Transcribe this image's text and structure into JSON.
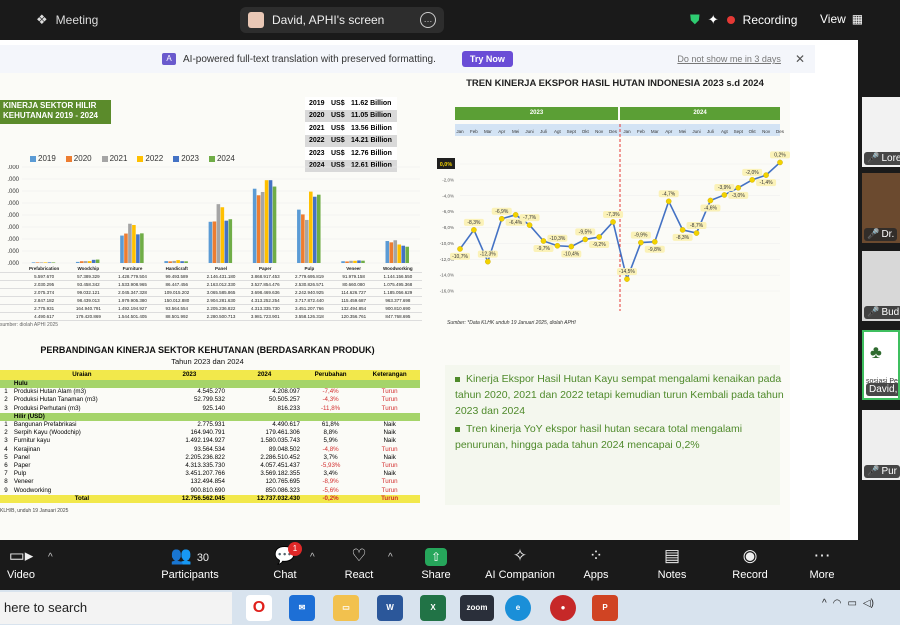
{
  "topbar": {
    "meeting_label": "Meeting",
    "screen_share_label": "David, APHI's screen",
    "recording_label": "Recording",
    "view_label": "View"
  },
  "notice": {
    "ai_text": "AI-powered full-text translation with preserved formatting.",
    "try_label": "Try Now",
    "dont_show": "Do not show me in 3 days"
  },
  "left_chart": {
    "title_lines": [
      "KINERJA SEKTOR HILIR",
      "KEHUTANAN 2019 - 2024"
    ],
    "annotations": [
      {
        "year": "2019",
        "cur": "US$",
        "value": "11.62 Billion"
      },
      {
        "year": "2020",
        "cur": "US$",
        "value": "11.05 Billion"
      },
      {
        "year": "2021",
        "cur": "US$",
        "value": "13.56 Billion"
      },
      {
        "year": "2022",
        "cur": "US$",
        "value": "14.21 Billion"
      },
      {
        "year": "2023",
        "cur": "US$",
        "value": "12.76 Billion"
      },
      {
        "year": "2024",
        "cur": "US$",
        "value": "12.61 Billion"
      }
    ],
    "y_ticks": [
      ".000",
      ".000",
      ".000",
      ".000",
      ".000",
      ".000",
      ".000",
      ".000",
      ".000"
    ],
    "source_note": "sumber: diolah APHI 2025",
    "table_headers": [
      "Prefabrication",
      "Woodchip",
      "Furniture",
      "Handicraft",
      "Panel",
      "Paper",
      "Pulp",
      "Veneer",
      "Woodworking"
    ],
    "table_rows": [
      [
        "5.597.670",
        "57.389.329",
        "1.428.779.504",
        "99.493.589",
        "2.146.431.180",
        "3.868.917.453",
        "2.779.695.819",
        "91.979.158",
        "1.144.156.550"
      ],
      [
        "2.030.295",
        "93.458.342",
        "1.533.908.965",
        "86.447.456",
        "2.163.012.330",
        "3.527.854.476",
        "2.530.826.571",
        "80.660.080",
        "1.075.495.368"
      ],
      [
        "2.075.374",
        "99.032.121",
        "2.045.347.328",
        "109.015.202",
        "3.065.585.865",
        "3.698.469.636",
        "2.242.940.925",
        "114.626.727",
        "1.185.056.629"
      ],
      [
        "2.847.182",
        "98.439.013",
        "1.979.905.380",
        "150.012.880",
        "2.904.281.630",
        "4.313.252.254",
        "3.717.872.440",
        "115.459.687",
        "963.377.698"
      ],
      [
        "2.775.931",
        "164.940.791",
        "1.492.194.927",
        "93.564.554",
        "2.205.236.822",
        "4.313.335.730",
        "3.451.207.766",
        "132.494.854",
        "900.810.690"
      ],
      [
        "4.490.617",
        "179.420.869",
        "1.544.501.405",
        "88.501.992",
        "2.280.500.713",
        "3.981.723.901",
        "3.558.126.318",
        "120.356.761",
        "847.768.695"
      ]
    ]
  },
  "chart_data": [
    {
      "type": "bar",
      "title": "KINERJA SEKTOR HILIR KEHUTANAN 2019 - 2024",
      "categories": [
        "Prefabrication",
        "Woodchip",
        "Furniture",
        "Handicraft",
        "Panel",
        "Paper",
        "Pulp",
        "Veneer",
        "Woodworking"
      ],
      "series": [
        {
          "name": "2019",
          "color": "#5b9bd5",
          "values": [
            5597670,
            57389329,
            1428779504,
            99493589,
            2146431180,
            3868917453,
            2779695819,
            91979158,
            1144156550
          ]
        },
        {
          "name": "2020",
          "color": "#ed7d31",
          "values": [
            2030295,
            93458342,
            1533908965,
            86447456,
            2163012330,
            3527854476,
            2530826571,
            80660080,
            1075495368
          ]
        },
        {
          "name": "2021",
          "color": "#a5a5a5",
          "values": [
            2075374,
            99032121,
            2045347328,
            109015202,
            3065585865,
            3698469636,
            2242940925,
            114626727,
            1185056629
          ]
        },
        {
          "name": "2022",
          "color": "#ffc000",
          "values": [
            2847182,
            98439013,
            1979905380,
            150012880,
            2904281630,
            4313252254,
            3717872440,
            115459687,
            963377698
          ]
        },
        {
          "name": "2023",
          "color": "#4472c4",
          "values": [
            2775931,
            164940791,
            1492194927,
            93564554,
            2205236822,
            4313335730,
            3451207766,
            132494854,
            900810690
          ]
        },
        {
          "name": "2024",
          "color": "#70ad47",
          "values": [
            4490617,
            179420869,
            1544501405,
            88501992,
            2280500713,
            3981723901,
            3558126318,
            120356761,
            847768695
          ]
        }
      ],
      "ylim": [
        0,
        5000000000
      ]
    },
    {
      "type": "line",
      "title": "TREN KINERJA EKSPOR HASIL HUTAN INDONESIA 2023 s.d 2024",
      "x": [
        "Jan",
        "Feb",
        "Mar",
        "Apr",
        "Mei",
        "Juni",
        "Juli",
        "Agt",
        "Sept",
        "Okt",
        "Nov",
        "Des",
        "Jan",
        "Feb",
        "Mar",
        "Apr",
        "Mei",
        "Juni",
        "Juli",
        "Agt",
        "Sept",
        "Okt",
        "Nov",
        "Des"
      ],
      "values": [
        -10.7,
        -8.3,
        -12.3,
        -6.9,
        -6.4,
        -7.7,
        -9.7,
        -10.3,
        -10.4,
        -9.5,
        -9.2,
        -7.3,
        -14.5,
        -9.9,
        -9.8,
        -4.7,
        -8.3,
        -8.7,
        -4.6,
        -3.9,
        -3.0,
        -2.0,
        -1.4,
        0.2
      ],
      "labels": [
        "-10,7%",
        "-8,3%",
        "-12,3%",
        "-6,9%",
        "-6,4%",
        "-7,7%",
        "-9,7%",
        "-10,3%",
        "-10,4%",
        "-9,5%",
        "-9,2%",
        "-7,3%",
        "-14,5%",
        "-9,9%",
        "-9,8%",
        "-4,7%",
        "-8,3%",
        "-8,7%",
        "-4,6%",
        "-3,9%",
        "-3,0%",
        "-2,0%",
        "-1,4%",
        "0,2%"
      ],
      "year_bands": [
        "2023",
        "2024"
      ],
      "ylim": [
        -16,
        0
      ],
      "y_ticks": [
        "0,0%",
        "-2,0%",
        "-4,0%",
        "-6,0%",
        "-8,0%",
        "-10,0%",
        "-12,0%",
        "-14,0%",
        "-16,0%"
      ],
      "zero_label": "0,0%",
      "line_color": "#4472c4",
      "marker_color": "#f2d200"
    }
  ],
  "right_chart_meta": {
    "source": "Sumber: *Data KLHK unduh 19 Januari 2025, diolah APHI"
  },
  "bullets": [
    "Kinerja Ekspor Hasil Hutan Kayu sempat mengalami kenaikan pada tahun 2020, 2021 dan 2022 tetapi kemudian turun Kembali pada tahun 2023 dan 2024",
    "Tren kinerja YoY ekspor hasil hutan secara total mengalami penurunan, hingga pada tahun 2024 mencapai 0,2%"
  ],
  "comparison": {
    "title": "PERBANDINGAN KINERJA SEKTOR KEHUTANAN (BERDASARKAN PRODUK)",
    "subtitle": "Tahun 2023 dan 2024",
    "headers": [
      "Uraian",
      "2023",
      "2024",
      "Perubahan",
      "Keterangan"
    ],
    "group_hulu": "Hulu",
    "group_hilir": "Hilir (USD)",
    "rows_hulu": [
      {
        "no": "1",
        "name": "Produksi Hutan Alam (m3)",
        "v2023": "4.545.270",
        "v2024": "4.208.097",
        "chg": "-7,4%",
        "ket": "Turun"
      },
      {
        "no": "2",
        "name": "Produksi Hutan Tanaman (m3)",
        "v2023": "52.799.532",
        "v2024": "50.505.257",
        "chg": "-4,3%",
        "ket": "Turun"
      },
      {
        "no": "3",
        "name": "Produksi Perhutani (m3)",
        "v2023": "925.140",
        "v2024": "816.233",
        "chg": "-11,8%",
        "ket": "Turun"
      }
    ],
    "rows_hilir": [
      {
        "no": "1",
        "name": "Bangunan Prefabrikasi",
        "v2023": "2.775.931",
        "v2024": "4.490.617",
        "chg": "61,8%",
        "ket": "Naik"
      },
      {
        "no": "2",
        "name": "Serpih Kayu (Woodchip)",
        "v2023": "164.940.791",
        "v2024": "179.461.306",
        "chg": "8,8%",
        "ket": "Naik"
      },
      {
        "no": "3",
        "name": "Furnitur kayu",
        "v2023": "1.492.194.927",
        "v2024": "1.580.035.743",
        "chg": "5,9%",
        "ket": "Naik"
      },
      {
        "no": "4",
        "name": "Kerajinan",
        "v2023": "93.564.534",
        "v2024": "89.048.502",
        "chg": "-4,8%",
        "ket": "Turun"
      },
      {
        "no": "5",
        "name": "Panel",
        "v2023": "2.205.236.822",
        "v2024": "2.286.510.452",
        "chg": "3,7%",
        "ket": "Naik"
      },
      {
        "no": "6",
        "name": "Paper",
        "v2023": "4.313.335.730",
        "v2024": "4.057.451.437",
        "chg": "-5,93%",
        "ket": "Turun"
      },
      {
        "no": "7",
        "name": "Pulp",
        "v2023": "3.451.207.766",
        "v2024": "3.569.182.355",
        "chg": "3,4%",
        "ket": "Naik"
      },
      {
        "no": "8",
        "name": "Veneer",
        "v2023": "132.494.854",
        "v2024": "120.765.695",
        "chg": "-8,9%",
        "ket": "Turun"
      },
      {
        "no": "9",
        "name": "Woodworking",
        "v2023": "900.810.690",
        "v2024": "850.086.323",
        "chg": "-5,6%",
        "ket": "Turun"
      }
    ],
    "total": {
      "name": "Total",
      "v2023": "12.756.562.045",
      "v2024": "12.737.032.430",
      "chg": "-0,2%",
      "ket": "Turun"
    },
    "note": "KLH/B, unduh 19 Januari 2025"
  },
  "participants": [
    {
      "name": "Lore"
    },
    {
      "name": "Dr."
    },
    {
      "name": "Bud"
    },
    {
      "name": "David,",
      "sub": "sosiasi Pe"
    },
    {
      "name": "Pur"
    }
  ],
  "toolbar": {
    "video": "Video",
    "participants": "Participants",
    "participants_count": "30",
    "chat": "Chat",
    "chat_badge": "1",
    "react": "React",
    "share": "Share",
    "ai_companion": "AI Companion",
    "apps": "Apps",
    "notes": "Notes",
    "record": "Record",
    "more": "More"
  },
  "taskbar": {
    "search": "here to search",
    "apps": [
      "opera",
      "mail",
      "files",
      "word",
      "excel",
      "zoom",
      "edge",
      "record",
      "powerpoint"
    ]
  }
}
